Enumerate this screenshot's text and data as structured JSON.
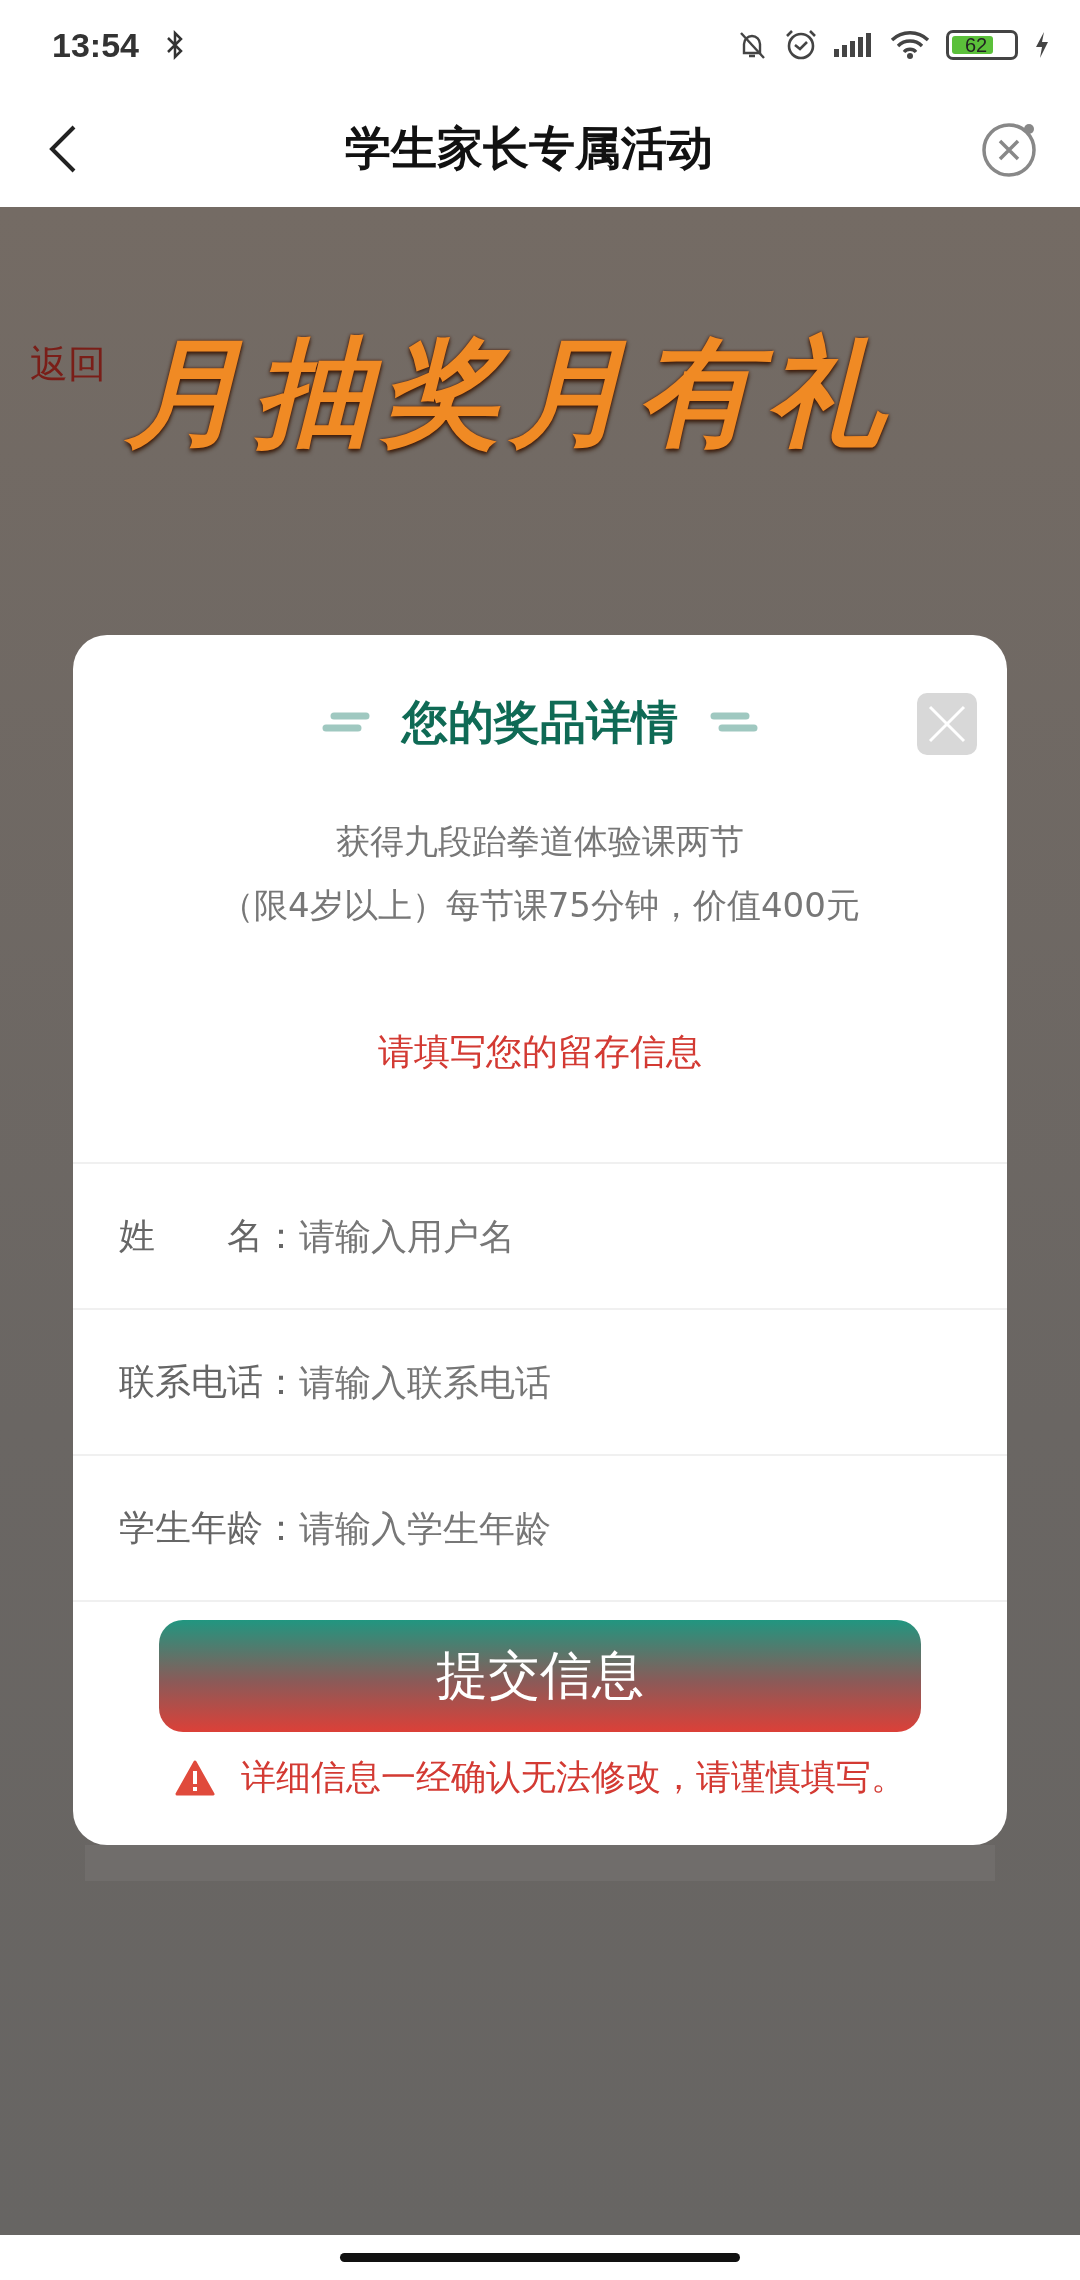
{
  "status_bar": {
    "time": "13:54",
    "battery": "62"
  },
  "nav": {
    "title": "学生家长专属活动"
  },
  "banner": {
    "back_link": "返回",
    "title": "月抽奖月有礼"
  },
  "dialog": {
    "title": "您的奖品详情",
    "description": [
      "获得九段跆拳道体验课两节",
      "（限4岁以上）每节课75分钟，价值400元"
    ],
    "prompt": "请填写您的留存信息",
    "fields": [
      {
        "label": "姓　　名：",
        "placeholder": "请输入用户名"
      },
      {
        "label": "联系电话：",
        "placeholder": "请输入联系电话"
      },
      {
        "label": "学生年龄：",
        "placeholder": "请输入学生年龄"
      }
    ],
    "submit": "提交信息",
    "warning": "详细信息一经确认无法修改，请谨慎填写。"
  }
}
